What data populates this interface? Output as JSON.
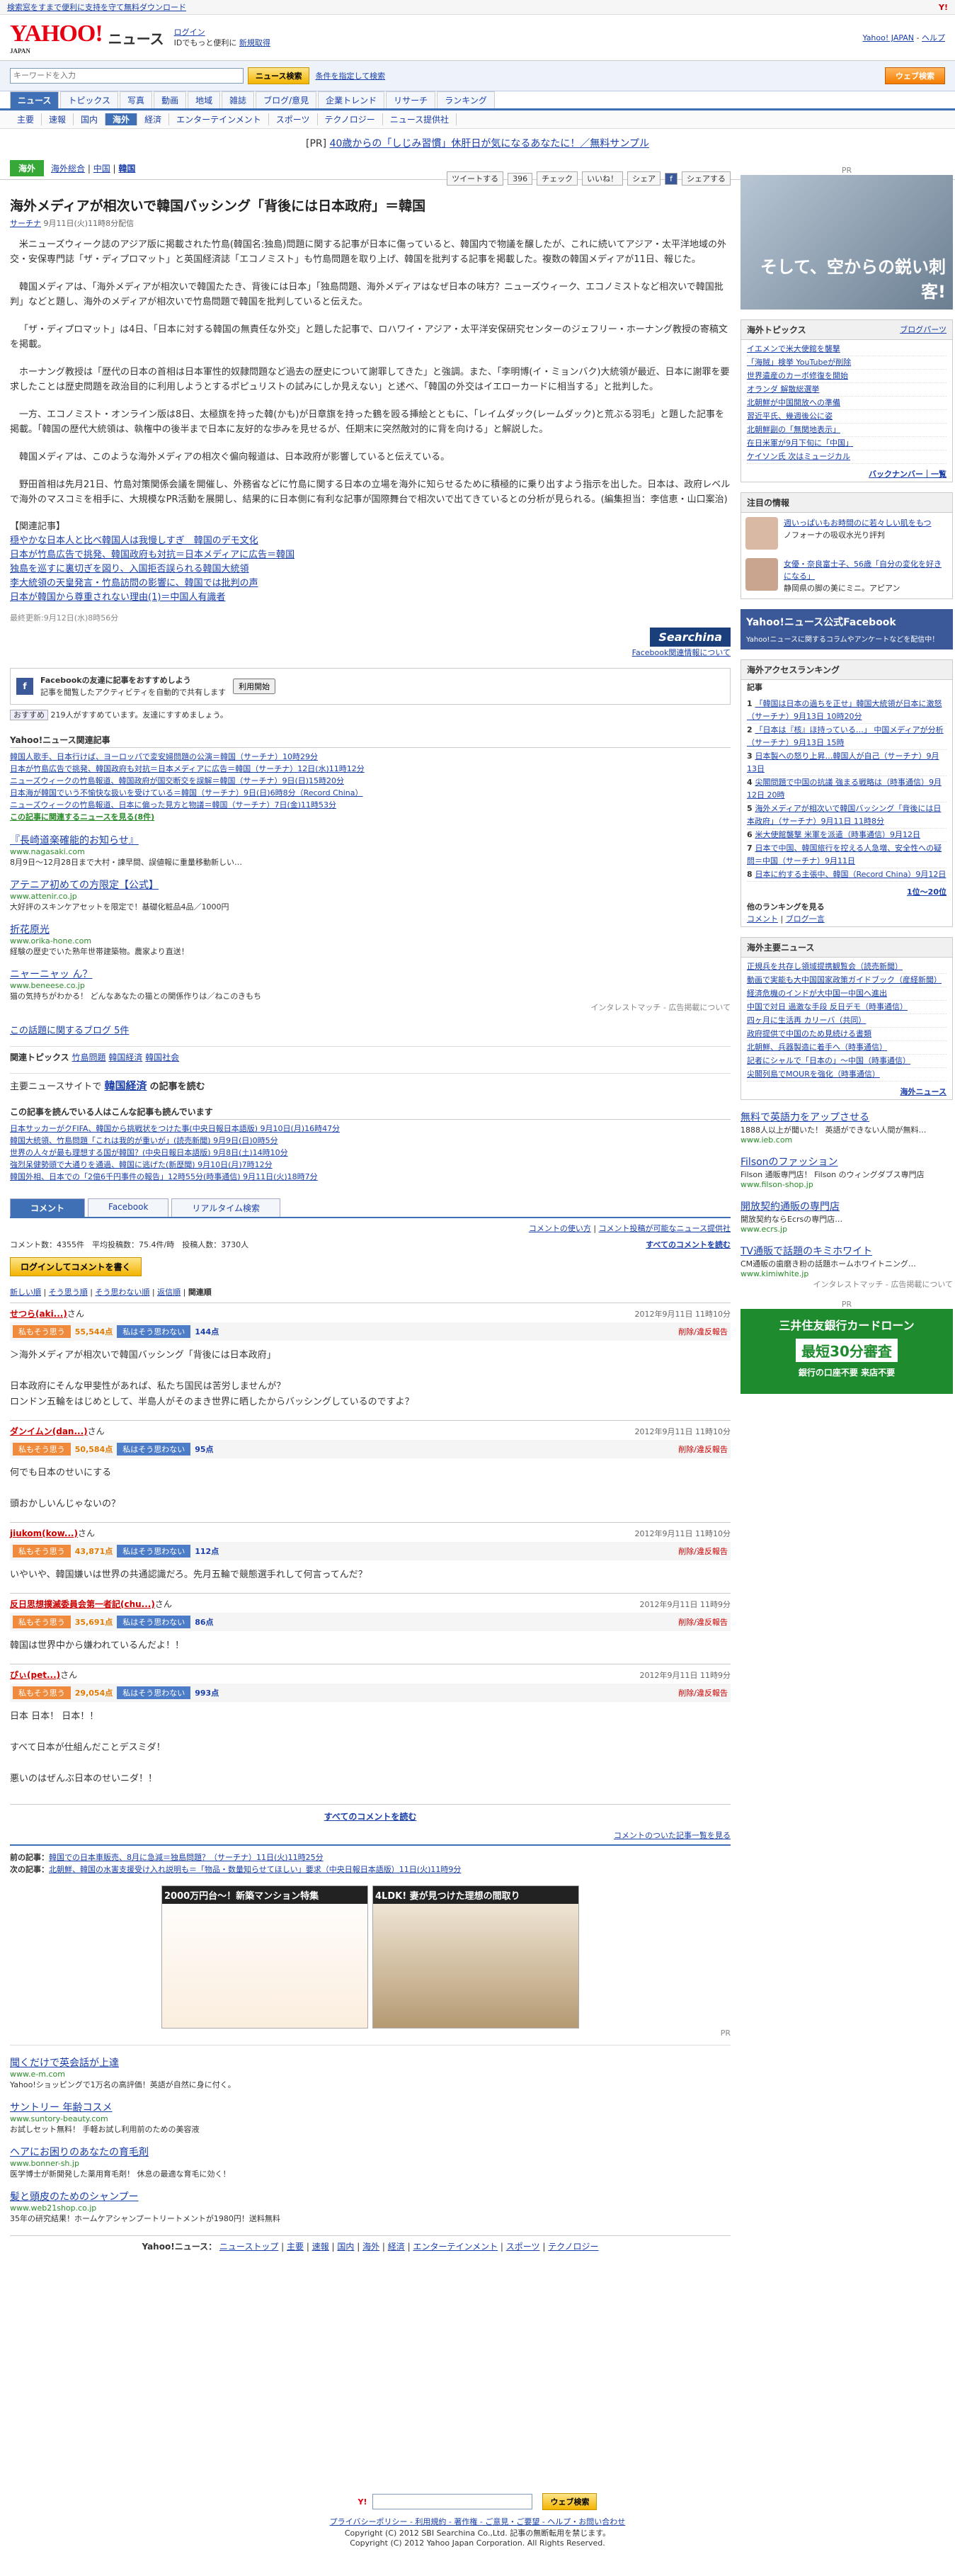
{
  "topbar": {
    "left": "検索窓をすまで便利に支持を守て無料ダウンロード",
    "right": "Y!"
  },
  "header": {
    "logo": "YAHOO!",
    "logo_sub": "JAPAN",
    "service": "ニュース",
    "login": "ログイン",
    "login_note": "IDでもっと便利に",
    "signup": "新規取得",
    "top_link": "Yahoo! JAPAN",
    "help": "ヘルプ"
  },
  "search": {
    "placeholder": "キーワードを入力",
    "button": "ニュース検索",
    "advanced": "条件を指定して検索",
    "web_button": "ウェブ検索"
  },
  "gnav": [
    "ニュース",
    "トピックス",
    "写真",
    "動画",
    "地域",
    "雑誌",
    "ブログ/意見",
    "企業トレンド",
    "リサーチ",
    "ランキング"
  ],
  "snav": [
    "主要",
    "速報",
    "国内",
    "海外",
    "経済",
    "エンターテインメント",
    "スポーツ",
    "テクノロジー",
    "ニュース提供社"
  ],
  "pr": {
    "tag": "[PR]",
    "text": "40歳からの「しじみ習慣」休肝日が気になるあなたに！／無料サンプル"
  },
  "category": {
    "label": "海外",
    "links": [
      "海外総合",
      "中国",
      "韓国"
    ]
  },
  "social": {
    "tweet": "ツイートする",
    "tweet_count": "396",
    "check": "チェック",
    "like": "いいね！",
    "share": "シェア",
    "facebook": "f",
    "mixi": "シェアする"
  },
  "article": {
    "title": "海外メディアが相次いで韓国バッシング「背後には日本政府」＝韓国",
    "source": "サーチナ",
    "date": "9月11日(火)11時8分配信",
    "paragraphs": [
      "米ニューズウィーク誌のアジア版に掲載された竹島(韓国名:独島)問題に関する記事が日本に傷っていると、韓国内で物議を醸したが、これに続いてアジア・太平洋地域の外交・安保専門誌「ザ・ディプロマット」と英国経済誌「エコノミスト」も竹島問題を取り上げ、韓国を批判する記事を掲載した。複数の韓国メディアが11日、報じた。",
      "韓国メディアは、「海外メディアが相次いで韓国たたき、背後には日本」「独島問題、海外メディアはなぜ日本の味方？ニューズウィーク、エコノミストなど相次いで韓国批判」などと題し、海外のメディアが相次いで竹島問題で韓国を批判していると伝えた。",
      "「ザ・ディプロマット」は4日、「日本に対する韓国の無責任な外交」と題した記事で、ロハワイ・アジア・太平洋安保研究センターのジェフリー・ホーナング教授の寄稿文を掲載。",
      "ホーナング教授は「歴代の日本の首相は日本軍性的奴隷問題など過去の歴史について謝罪してきた」と強調。また、「李明博(イ・ミョンバク)大統領が最近、日本に謝罪を要求したことは歴史問題を政治目的に利用しようとするポピュリストの試みにしか見えない」と述べ、「韓国の外交はイエローカードに相当する」と批判した。",
      "一方、エコノミスト・オンライン版は8日、太極旗を持った韓(かも)が日章旗を持った鶴を殴る挿絵とともに、「レイムダック(レームダック)と荒ぶる羽毛」と題した記事を掲載。「韓国の歴代大統領は、執権中の後半まで日本に友好的な歩みを見せるが、任期末に突然敵対的に背を向ける」と解説した。",
      "韓国メディアは、このような海外メディアの相次ぐ偏向報道は、日本政府が影響していると伝えている。",
      "野田首相は先月21日、竹島対策関係会議を開催し、外務省などに竹島に関する日本の立場を海外に知らせるために積極的に乗り出すよう指示を出した。日本は、政府レベルで海外のマスコミを相手に、大規模なPR活動を展開し、結果的に日本側に有利な記事が国際舞台で相次いで出てきているとの分析が見られる。(編集担当：李信恵・山口案治)"
    ],
    "related_heading": "【関連記事】",
    "related": [
      "穏やかな日本人と比べ韓国人は我慢しすぎ　韓国のデモ文化",
      "日本が竹島広告で挑発、韓国政府も対抗＝日本メディアに広告＝韓国",
      "独島を巡すに裏切ぎを図り、入国拒否誤られる韓国大統領",
      "李大統領の天皇発言・竹島訪問の影響に、韓国では批判の声",
      "日本が韓国から尊重されない理由(1)＝中国人有識者"
    ],
    "updated": "最終更新:9月12日(水)8時56分",
    "provider": "Searchina",
    "provider_link": "Facebook関連情報について"
  },
  "fbbox": {
    "title": "Facebookの友達に記事をおすすめしよう",
    "desc": "記事を閲覧したアクティビティを自動的で共有します",
    "btn": "利用開始",
    "like": "おすすめ",
    "count": "219人がすすめています。友達にすすめましょう。"
  },
  "yahoo_related": {
    "heading": "Yahoo!ニュース関連記事",
    "items": [
      "韓国人歌手、日本行けば、ヨーロッパで変安婦問題の公演＝韓国（サーチナ）10時29分",
      "日本が竹島広告で挑発、韓国政府も対抗＝日本メディアに広告＝韓国（サーチナ）12日(水)11時12分",
      "ニューズウィークの竹島報道、韓国政府が国交断交を誤解＝韓国（サーチナ）9日(日)15時20分",
      "日本海が韓国でいう不愉快な扱いを受けている＝韓国（サーチナ）9日(日)6時8分（Record China）",
      "ニューズウィークの竹島報道、日本に偏った見方と物議＝韓国（サーチナ）7日(金)11時53分"
    ],
    "more": "この記事に関連するニュースを見る(8件)"
  },
  "ads1": [
    {
      "title": "『長崎道楽確能的お知らせ』",
      "url": "www.nagasaki.com",
      "desc": "8月9日〜12月28日まで大村・諫早間、誤値報に重量移動新しい…"
    },
    {
      "title": "アテニア初めての方限定【公式】",
      "url": "www.attenir.co.jp",
      "desc": "大好評のスキンケアセットを限定で！基礎化粧品4品／1000円"
    },
    {
      "title": "折花原光",
      "url": "www.orika-hone.com",
      "desc": "経験の歴史でいた熟年世帯建築物。農家より直送！"
    },
    {
      "title": "ニャーニャッ ん？",
      "url": "www.beneese.co.jp",
      "desc": "猫の気持ちがわかる！ どんなあなたの猫との関係作りは／ねこのきもち"
    }
  ],
  "ad_note": "インタレストマッチ - 広告掲載について",
  "blog_line": "この話題に関するブログ 5件",
  "topics": {
    "label": "関連トピックス",
    "items": [
      "竹島問題",
      "韓国経済",
      "韓国社会"
    ]
  },
  "main_news": {
    "label": "主要ニュースサイトで",
    "kw": "韓国経済",
    "suffix": "の記事を読む"
  },
  "also_read": {
    "heading": "この記事を読んでいる人はこんな記事も読んでいます",
    "items": [
      "日本サッカーがクFIFA、韓国から挑戦状をつけた事(中央日報日本語版) 9月10日(月)16時47分",
      "韓国大統領、竹島問題「これは我的が重いが」(読売新聞) 9月9日(日)0時5分",
      "世界の人々が最も理想する国が韓国？(中央日報日本語版) 9月8日(土)14時10分",
      "強烈呆健勢頭で大通りを通過、韓国に逃げた(新歴聞) 9月10日(月)7時12分",
      "韓国外相、日本での「2億6千円事件の報告」12時55分(時事通信) 9月11日(火)18時7分"
    ]
  },
  "tabs": [
    "コメント",
    "Facebook",
    "リアルタイム検索"
  ],
  "comment_meta": {
    "rules": "コメントの使い方",
    "rules2": "コメント投稿が可能なニュース提供社",
    "stats": "コメント数：4355件　平均投稿数：75.4件/時　投稿人数：3730人",
    "all": "すべてのコメントを読む",
    "login": "ログインしてコメントを書く",
    "sorts": [
      "新しい順",
      "そう思う順",
      "そう思わない順",
      "返信順",
      "関連順"
    ]
  },
  "comments": [
    {
      "name": "せつら(aki...)",
      "date": "2012年9月11日 11時10分",
      "agree": "55,544点",
      "disagree": "144点",
      "body": [
        "＞海外メディアが相次いで韓国バッシング「背後には日本政府」",
        "日本政府にそんな甲斐性があれば、私たち国民は苦労しませんが？",
        "ロンドン五輪をはじめとして、半島人がそのまき世界に晒したからバッシングしているのですよ？"
      ]
    },
    {
      "name": "ダンイムン(dan...)",
      "date": "2012年9月11日 11時10分",
      "agree": "50,584点",
      "disagree": "95点",
      "body": [
        "何でも日本のせいにする",
        "頭おかしいんじゃないの？"
      ]
    },
    {
      "name": "jiukom(kow...)",
      "date": "2012年9月11日 11時10分",
      "agree": "43,871点",
      "disagree": "112点",
      "body": [
        "いやいや、韓国嫌いは世界の共通認識だろ。先月五輪で競態選手れして何言ってんだ？"
      ]
    },
    {
      "name": "反日思想撲滅委員会第一者記(chu...)",
      "date": "2012年9月11日 11時9分",
      "agree": "35,691点",
      "disagree": "86点",
      "body": [
        "韓国は世界中から嫌われているんだよ！！"
      ]
    },
    {
      "name": "ぴぃ(pet...)",
      "date": "2012年9月11日 11時9分",
      "agree": "29,054点",
      "disagree": "993点",
      "body": [
        "日本 日本！ 日本！！",
        "すべて日本が仕組んだことデスミダ！",
        "悪いのはぜんぶ日本のせいニダ！！"
      ]
    }
  ],
  "vote": {
    "agree": "私もそう思う",
    "disagree": "私はそう思わない",
    "report": "削除/違反報告"
  },
  "comments_all": "すべてのコメントを読む",
  "ranking_link": "コメントのついた記事一覧を見る",
  "prevnext": {
    "prev_label": "前の記事：",
    "prev": "韓国での日本車販売、8月に急減＝独島問題？（サーチナ）11日(火)11時25分",
    "next_label": "次の記事：",
    "next": "北朝鮮、韓国の水害支援受け入れ説明も＝「物品・数量知らせてほしい」要求（中央日報日本語版）11日(火)11時9分"
  },
  "ad_banner": {
    "left": "2000万円台〜！新築マンション特集",
    "right": "4LDK! 妻が見つけた理想の間取り",
    "pr": "PR"
  },
  "ads2": [
    {
      "title": "聞くだけで英会話が上達",
      "url": "www.e-m.com",
      "desc": "Yahoo!ショッピングで1万名の高評価！英語が自然に身に付く。"
    },
    {
      "title": "サントリー 年齢コスメ",
      "url": "www.suntory-beauty.com",
      "desc": "お試しセット無料！ 手軽お試し利用前のための美容液"
    },
    {
      "title": "ヘアにお困りのあなたの育毛剤",
      "url": "www.bonner-sh.jp",
      "desc": "医学博士が新開発した薬用育毛剤！ 休息の最適な育毛に効く！"
    },
    {
      "title": "髪と頭皮のためのシャンプー",
      "url": "www.web21shop.co.jp",
      "desc": "35年の研究結果！ホームケアシャンプートリートメントが1980円！送料無料"
    }
  ],
  "bottom_nav": {
    "label": "Yahoo!ニュース：",
    "items": [
      "ニューストップ",
      "主要",
      "速報",
      "国内",
      "海外",
      "経済",
      "エンターテインメント",
      "スポーツ",
      "テクノロジー"
    ]
  },
  "footer": {
    "links": "プライバシーポリシー - 利用規約 - 著作権 - ご意見・ご要望 - ヘルプ・お問い合わせ",
    "copy1": "Copyright (C) 2012 SBI Searchina Co.,Ltd. 記事の無断転用を禁じます。",
    "copy2": "Copyright (C) 2012 Yahoo Japan Corporation. All Rights Reserved."
  },
  "side": {
    "pr": "PR",
    "banner_caption": "そして、空からの鋭い刺客!",
    "topics_title": "海外トピックス",
    "topics_more": "ブログパーツ",
    "topics": [
      "イエメンで米大使館を襲撃",
      "「海賊」検挙 YouTubeが削除",
      "世界遺産のカーボ修復を開始",
      "オランダ 解散総選挙",
      "北朝鮮が中国開放への準備",
      "習近平氏、幾週後公に姿",
      "北朝鮮副の「無関地表示」",
      "在日米軍が9月下旬に「中国」",
      "ケイソン氏 次はミュージカル"
    ],
    "topics_back": "バックナンバー｜一覧",
    "people_title": "注目の情報",
    "people": [
      {
        "text": "週いっぱいもお時間のに若々しい肌をもつ",
        "sub": "ノフォーナの吸収水光り評判"
      },
      {
        "text": "女優・奈良富士子、56歳「自分の変化を好きになる」",
        "sub": "静岡県の脚の美にミニ。アピアン"
      }
    ],
    "fb_banner": "Yahoo!ニュース公式Facebook",
    "fb_desc": "Yahoo!ニュースに関するコラムやアンケートなどを配信中！",
    "ranking_title": "海外アクセスランキング",
    "ranking_sub": "記事",
    "ranking": [
      "「韓国は日本の過ちを正せ」韓国大統領が日本に激怒（サーチナ）9月13日 10時20分",
      "「日本は『核』ほ持っている…」 中国メディアが分析（サーチナ）9月13日 15時",
      "日本製への怒り上昇…韓国人が自己（サーチナ）9月13日",
      "尖閣問題で中国の抗議 強まる戦略は（時事通信）9月12日 20時",
      "海外メディアが相次いで韓国バッシング「背後には日本政府」（サーチナ）9月11日 11時8分",
      "米大使館襲撃 米軍を派遣（時事通信）9月12日",
      "日本で中国、韓国旅行を控える人急増、安全性への疑問＝中国（サーチナ）9月11日",
      "日本に約する主張中、韓国（Record China）9月12日"
    ],
    "ranking_more": "1位〜20位",
    "ranking_other": "他のランキングを見る",
    "ranking_other_links": [
      "コメント",
      "ブログ一言"
    ],
    "main_title": "海外主要ニュース",
    "main_items": [
      "正規兵を共存し領域提携観覧会（読売新聞）",
      "動画で実能も大中国国家政策ガイドブック（産経新聞）",
      "経済危機のインドが大中国一中国へ進出",
      "中国で対日 過激な手段 反日デモ（時事通信）",
      "四ヶ月に生活再 カリーバ（共同）",
      "政府提供で中国のため見続ける書類",
      "北朝鮮、兵器製造に着手へ（時事通信）",
      "記者にシャルで「日本の」〜中国（時事通信）",
      "尖閣列島でMOURを強化（時事通信）"
    ],
    "main_more": "海外ニュース",
    "ads": [
      {
        "title": "無料で英語力をアップさせる",
        "desc": "1888人以上が聞いた！ 英語ができない人間が無料…",
        "url": "www.ieb.com"
      },
      {
        "title": "Filsonのファッション",
        "desc": "Filson 通販専門店！ Filson のウィングダブス専門店",
        "url": "www.filson-shop.jp"
      },
      {
        "title": "開放契約通販の専門店",
        "desc": "開放契約ならEcrsの専門店…",
        "url": "www.ecrs.jp"
      },
      {
        "title": "TV通販で話題のキミホワイト",
        "desc": "CM通販の歯磨き粉の話題ホームホワイトニング…",
        "url": "www.kimiwhite.jp"
      }
    ],
    "ads_note": "インタレストマッチ - 広告掲載について",
    "loan_title": "三井住友銀行カードローン",
    "loan_big": "最短30分審査",
    "loan_sub": "銀行の口座不要 来店不要"
  }
}
